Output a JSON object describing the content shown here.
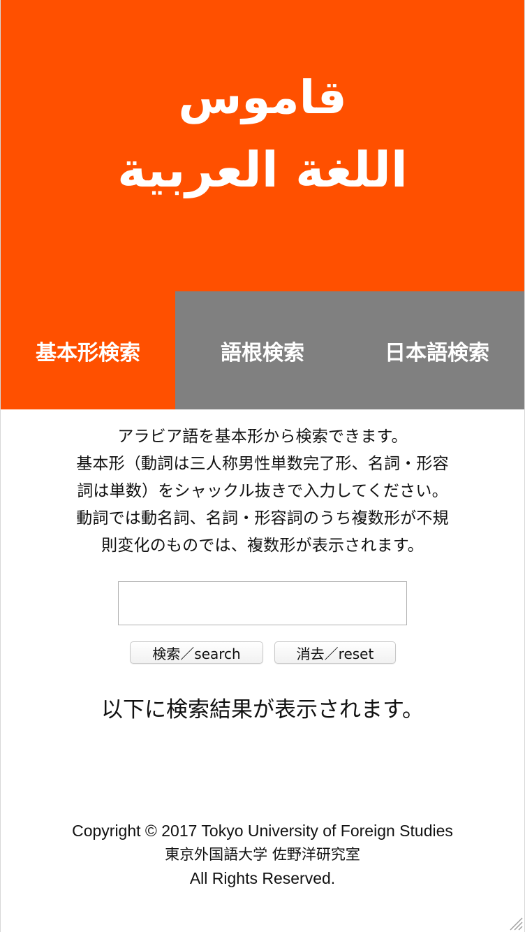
{
  "header": {
    "logo_line1": "قاموس",
    "logo_line2": "اللغة العربية",
    "background": "#ff5000"
  },
  "tabs": [
    {
      "label": "基本形検索",
      "active": true
    },
    {
      "label": "語根検索",
      "active": false
    },
    {
      "label": "日本語検索",
      "active": false
    }
  ],
  "description": {
    "lines": [
      "アラビア語を基本形から検索できます。",
      "基本形（動詞は三人称男性単数完了形、名詞・形容",
      "詞は単数）をシャックル抜きで入力してください。",
      "動詞では動名詞、名詞・形容詞のうち複数形が不規",
      "則変化のものでは、複数形が表示されます。"
    ]
  },
  "search": {
    "value": "",
    "placeholder": "",
    "search_label": "検索／search",
    "reset_label": "消去／reset"
  },
  "results": {
    "text": "以下に検索結果が表示されます。"
  },
  "footer": {
    "line1": "Copyright © 2017 Tokyo University of Foreign Studies",
    "line2": "東京外国語大学 佐野洋研究室",
    "line3": "All Rights Reserved."
  },
  "colors": {
    "accent": "#ff5000",
    "tab_inactive": "#808080"
  }
}
